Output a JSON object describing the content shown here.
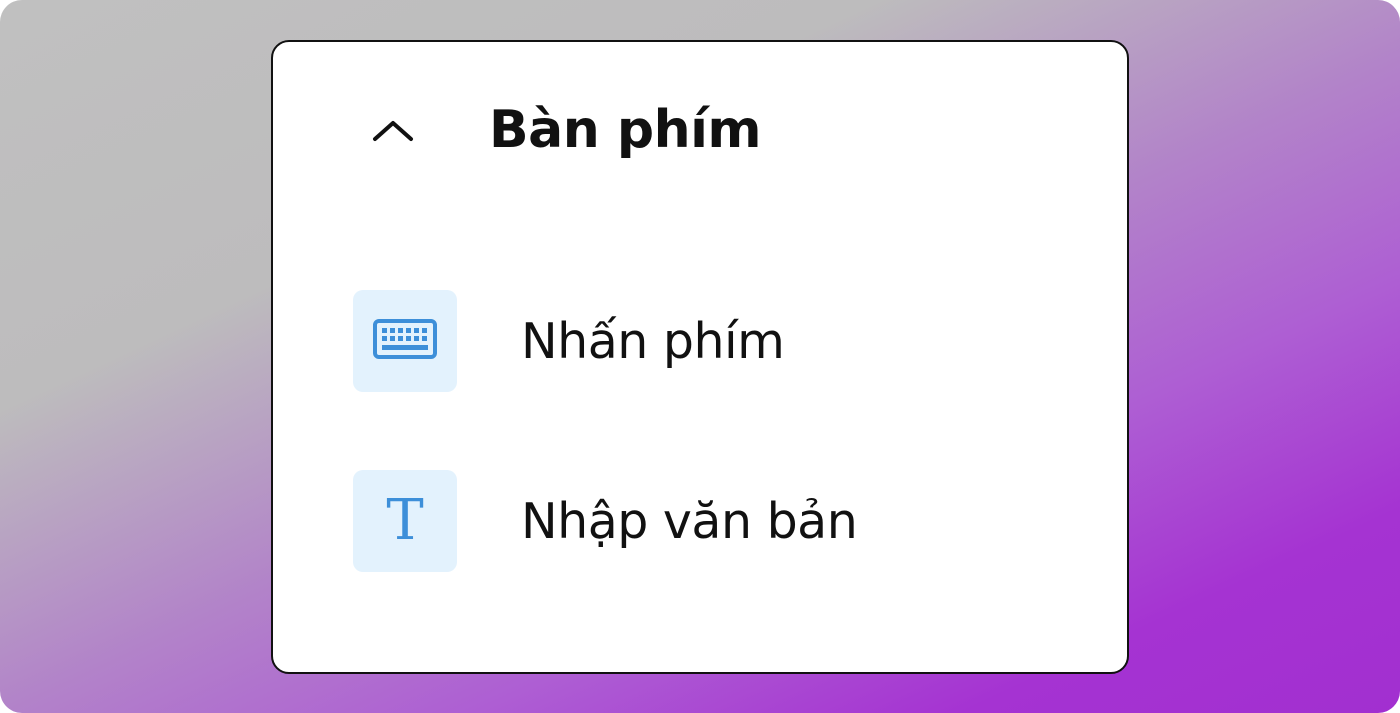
{
  "section": {
    "title": "Bàn phím",
    "chevron_icon": "chevron-up-icon",
    "expanded": true
  },
  "items": [
    {
      "label": "Nhấn phím",
      "icon": "keyboard-icon"
    },
    {
      "label": "Nhập văn bản",
      "icon": "text-t-icon",
      "glyph": "T"
    }
  ],
  "colors": {
    "icon_tile_bg": "#e3f2fd",
    "icon_accent": "#3d8fd9",
    "panel_bg": "#ffffff",
    "text": "#111111"
  }
}
